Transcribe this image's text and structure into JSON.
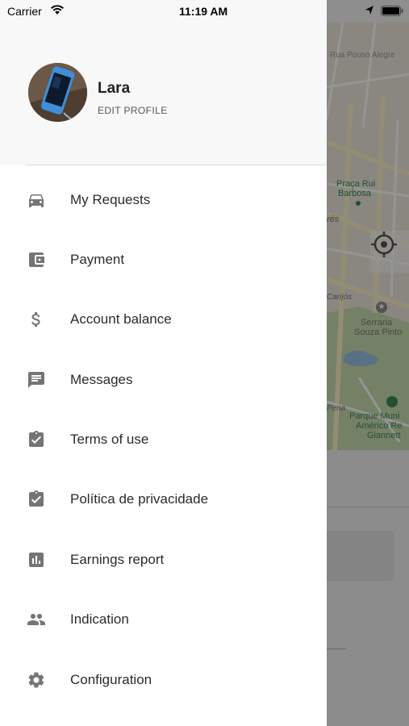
{
  "status_bar": {
    "carrier": "Carrier",
    "time": "11:19 AM"
  },
  "profile": {
    "name": "Lara",
    "edit_label": "EDIT PROFILE"
  },
  "menu": {
    "items": [
      {
        "label": "My Requests",
        "icon": "car-icon"
      },
      {
        "label": "Payment",
        "icon": "wallet-icon"
      },
      {
        "label": "Account balance",
        "icon": "dollar-icon"
      },
      {
        "label": "Messages",
        "icon": "message-icon"
      },
      {
        "label": "Terms of use",
        "icon": "clipboard-check-icon"
      },
      {
        "label": "Política de privacidade",
        "icon": "clipboard-check-icon"
      },
      {
        "label": "Earnings report",
        "icon": "bar-chart-icon"
      },
      {
        "label": "Indication",
        "icon": "people-icon"
      },
      {
        "label": "Configuration",
        "icon": "gear-icon"
      }
    ]
  },
  "map": {
    "labels": {
      "street_top": "Rua Pouso Alegre",
      "square_line1": "Praça Rui",
      "square_line2": "Barbosa",
      "street_res": "rés",
      "street_carijos": "Carijós",
      "serraria_line1": "Serraria",
      "serraria_line2": "Souza Pinto",
      "street_pena": "Pena",
      "park_line1": "Parque Muni",
      "park_line2": "Américo Re",
      "park_line3": "Giannett"
    }
  },
  "colors": {
    "icon": "#757575",
    "text": "#2b2b2b",
    "map_park": "#c8dfb0",
    "map_water": "#9cc3e6"
  }
}
